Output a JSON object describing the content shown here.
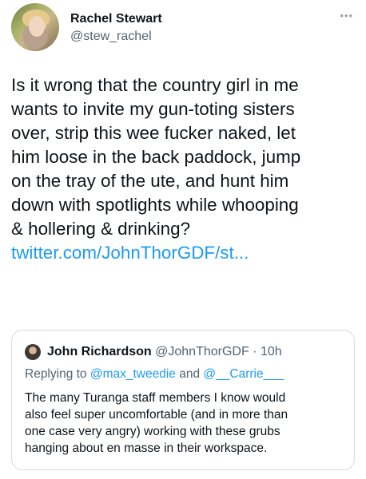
{
  "author": {
    "name": "Rachel Stewart",
    "handle": "@stew_rachel"
  },
  "more_menu": "•••",
  "tweet": {
    "lines": [
      "Is it wrong that the country girl in me",
      "wants to invite my gun-toting sisters",
      "over, strip this wee fucker naked, let",
      "him loose in the back paddock, jump",
      "on the tray of the ute, and hunt him",
      "down with spotlights while whooping",
      "& hollering & drinking?"
    ],
    "link": "twitter.com/JohnThorGDF/st..."
  },
  "quoted_tweet": {
    "name": "John Richardson",
    "handle": "@JohnThorGDF",
    "separator": " · ",
    "time": "10h",
    "replying_to": "Replying to",
    "mention_1": "@max_tweedie",
    "and": "and",
    "mention_2": "@__Carrie___",
    "lines": [
      "The many Turanga staff members I know would",
      "also feel super uncomfortable (and in more than",
      "one case very angry) working with these grubs",
      "hanging about en masse in their workspace."
    ]
  },
  "colors": {
    "link": "#1d9bf0",
    "text": "#0f1419",
    "secondary": "#536471",
    "border": "#d5dbe0"
  }
}
